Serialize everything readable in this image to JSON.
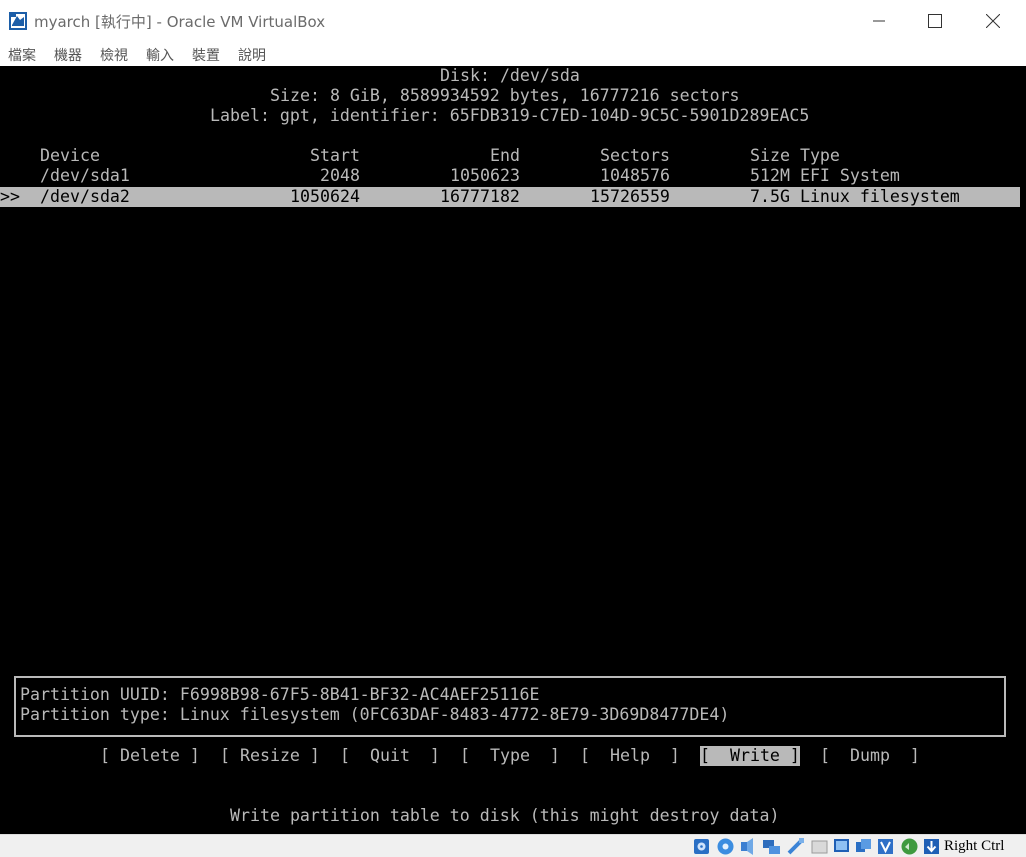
{
  "window": {
    "title": "myarch [執行中] - Oracle VM VirtualBox",
    "icon": "virtualbox-icon"
  },
  "menu": [
    "檔案",
    "機器",
    "檢視",
    "輸入",
    "裝置",
    "說明"
  ],
  "cfdisk": {
    "disk_line": "Disk: /dev/sda",
    "size_line": "Size: 8 GiB, 8589934592 bytes, 16777216 sectors",
    "label_line": "Label: gpt, identifier: 65FDB319-C7ED-104D-9C5C-5901D289EAC5",
    "columns": {
      "device": "Device",
      "start": "Start",
      "end": "End",
      "sectors": "Sectors",
      "size_type": "Size Type"
    },
    "partitions": [
      {
        "marker": "",
        "device": "/dev/sda1",
        "start": "2048",
        "end": "1050623",
        "sectors": "1048576",
        "size_type": "512M EFI System",
        "selected": false
      },
      {
        "marker": ">>",
        "device": "/dev/sda2",
        "start": "1050624",
        "end": "16777182",
        "sectors": "15726559",
        "size_type": "7.5G Linux filesystem",
        "selected": true
      }
    ],
    "info": {
      "uuid_line": "Partition UUID: F6998B98-67F5-8B41-BF32-AC4AEF25116E",
      "type_line": "Partition type: Linux filesystem (0FC63DAF-8483-4772-8E79-3D69D8477DE4)"
    },
    "actions": [
      {
        "id": "delete",
        "label": "[ Delete ]"
      },
      {
        "id": "resize",
        "label": "[ Resize ]"
      },
      {
        "id": "quit",
        "label": "[  Quit  ]"
      },
      {
        "id": "type",
        "label": "[  Type  ]"
      },
      {
        "id": "help",
        "label": "[  Help  ]"
      },
      {
        "id": "write",
        "label": "[  Write ]",
        "selected": true
      },
      {
        "id": "dump",
        "label": "[  Dump  ]"
      }
    ],
    "hint": "Write partition table to disk (this might destroy data)"
  },
  "statusbar": {
    "host_key": "Right Ctrl",
    "icons": [
      "hard-disk-icon",
      "optical-drive-icon",
      "audio-icon",
      "network-icon",
      "usb-icon",
      "shared-folders-icon",
      "display-icon",
      "recording-icon",
      "vrde-icon",
      "mouse-integration-icon",
      "keyboard-capture-icon"
    ]
  },
  "colors": {
    "terminal_bg": "#000000",
    "terminal_fg": "#b9b9b9",
    "highlight_bg": "#b9b9b9",
    "highlight_fg": "#000000"
  }
}
